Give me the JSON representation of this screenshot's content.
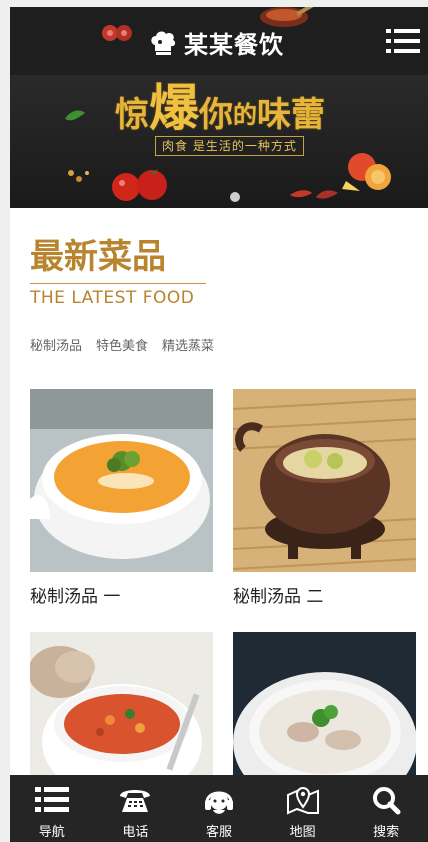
{
  "header": {
    "logo_text": "某某餐饮"
  },
  "banner": {
    "headline_1": "惊",
    "headline_2": "爆",
    "headline_3": "你",
    "headline_4": "的",
    "headline_5": "味蕾",
    "subline": "肉食 是生活的一种方式"
  },
  "section": {
    "title": "最新菜品",
    "subtitle": "THE LATEST FOOD",
    "tags": [
      "秘制汤品",
      "特色美食",
      "精选蒸菜"
    ]
  },
  "products": [
    {
      "caption": "秘制汤品 一"
    },
    {
      "caption": "秘制汤品 二"
    },
    {
      "caption": ""
    },
    {
      "caption": ""
    }
  ],
  "bottom_nav": [
    {
      "label": "导航",
      "icon": "list-icon"
    },
    {
      "label": "电话",
      "icon": "phone-icon"
    },
    {
      "label": "客服",
      "icon": "headset-icon"
    },
    {
      "label": "地图",
      "icon": "map-icon"
    },
    {
      "label": "搜索",
      "icon": "search-icon"
    }
  ],
  "colors": {
    "accent": "#b8842e",
    "header_bg": "#1e1e1e",
    "nav_bg": "#252525"
  }
}
